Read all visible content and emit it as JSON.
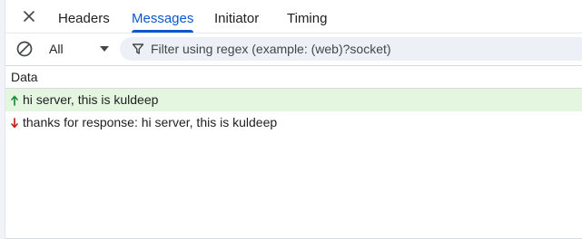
{
  "tabs": [
    {
      "label": "Headers",
      "active": false
    },
    {
      "label": "Messages",
      "active": true
    },
    {
      "label": "Initiator",
      "active": false
    },
    {
      "label": "Timing",
      "active": false
    }
  ],
  "toolbar": {
    "type_filter_value": "All",
    "filter_placeholder": "Filter using regex (example: (web)?socket)"
  },
  "table": {
    "column_header": "Data",
    "rows": [
      {
        "direction": "sent",
        "direction_icon": "arrow-up-icon",
        "text": "hi server, this is kuldeep",
        "color": "#1e8e3e"
      },
      {
        "direction": "received",
        "direction_icon": "arrow-down-icon",
        "text": "thanks for response: hi server, this is kuldeep",
        "color": "#c5221f"
      }
    ]
  },
  "colors": {
    "accent": "#0b57d0",
    "sent_row_bg": "#e4f5e0",
    "filter_bg": "#edf0f7"
  },
  "icons": {
    "close": "close-icon",
    "block": "block-icon",
    "filter": "filter-icon",
    "dropdown": "chevron-down-icon"
  }
}
